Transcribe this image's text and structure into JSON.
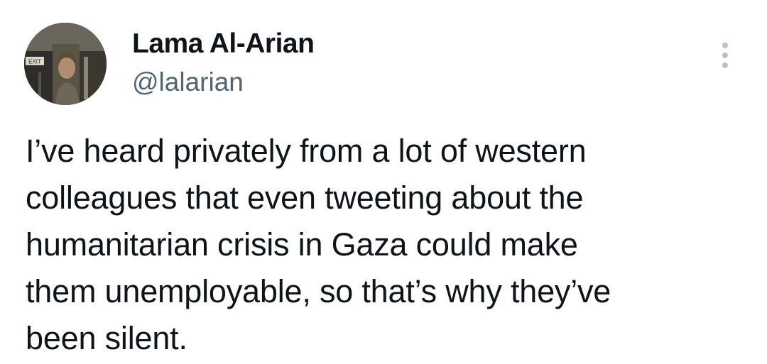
{
  "author": {
    "name": "Lama Al-Arian",
    "handle": "@lalarian",
    "avatar": "profile-photo",
    "avatar_sign_text": "EXIT"
  },
  "menu_icon": "more-vertical-icon",
  "tweet": {
    "lines": [
      "I’ve heard privately from a lot of western",
      "colleagues that even tweeting about the",
      "humanitarian crisis in Gaza could make",
      "them unemployable, so that’s why they’ve",
      "been silent."
    ]
  },
  "colors": {
    "text": "#0f1419",
    "secondary": "#536471",
    "menu_dots": "#b9c0c6"
  }
}
